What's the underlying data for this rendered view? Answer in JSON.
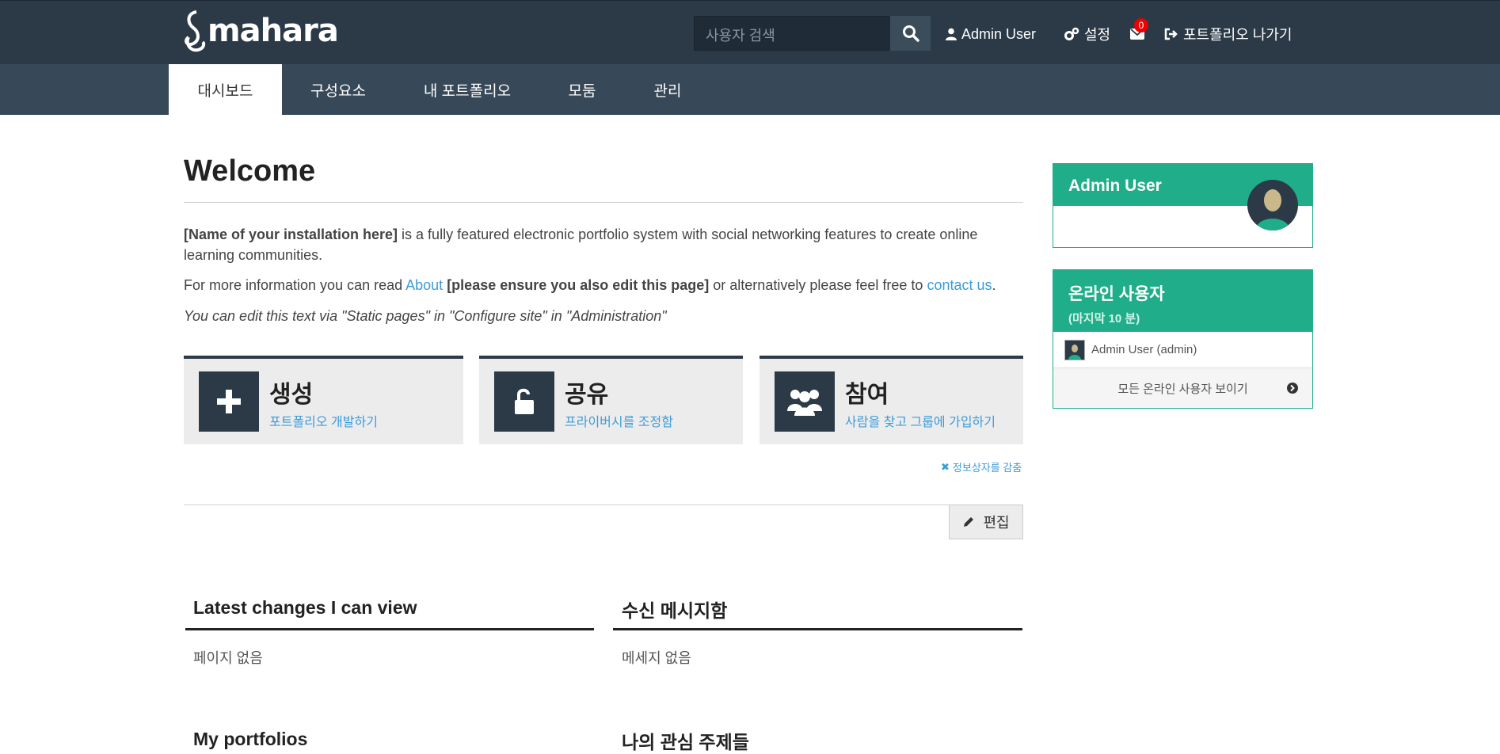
{
  "brand": {
    "logo_text": "mahara"
  },
  "header": {
    "search_placeholder": "사용자 검색",
    "user_name": "Admin User",
    "settings_label": "설정",
    "inbox_count": "0",
    "logout_label": "포트폴리오 나가기"
  },
  "nav": {
    "tabs": [
      {
        "label": "대시보드",
        "active": true
      },
      {
        "label": "구성요소",
        "active": false
      },
      {
        "label": "내 포트폴리오",
        "active": false
      },
      {
        "label": "모둠",
        "active": false
      },
      {
        "label": "관리",
        "active": false
      }
    ]
  },
  "welcome": {
    "title": "Welcome",
    "p1_bold": "[Name of your installation here]",
    "p1_rest": " is a fully featured electronic portfolio system with social networking features to create online learning communities.",
    "p2_a": "For more information you can read ",
    "p2_link1": "About",
    "p2_bold": " [please ensure you also edit this page]",
    "p2_b": " or alternatively please feel free to ",
    "p2_link2": "contact us",
    "p2_end": ".",
    "p3": "You can edit this text via \"Static pages\" in \"Configure site\" in \"Administration\""
  },
  "tiles": [
    {
      "title": "생성",
      "subtitle": "포트폴리오 개발하기",
      "icon": "plus-icon"
    },
    {
      "title": "공유",
      "subtitle": "프라이버시를 조정함",
      "icon": "unlock-icon"
    },
    {
      "title": "참여",
      "subtitle": "사람을 찾고 그룹에 가입하기",
      "icon": "users-icon"
    }
  ],
  "hide_info_label": "정보상자를 감춤",
  "edit_label": "편집",
  "blocks": {
    "latest_changes": {
      "title": "Latest changes I can view",
      "empty": "페이지 없음"
    },
    "inbox": {
      "title": "수신 메시지함",
      "empty": "메세지 없음"
    },
    "my_portfolios": {
      "title": "My portfolios"
    },
    "topics": {
      "title": "나의 관심 주제들"
    }
  },
  "sidebar": {
    "profile": {
      "name": "Admin User"
    },
    "online": {
      "title": "온라인 사용자",
      "subtitle": "(마지막 10 분)",
      "users": [
        "Admin User (admin)"
      ],
      "show_all": "모든 온라인 사용자 보이기"
    }
  },
  "colors": {
    "header": "#2c3a47",
    "nav": "#374858",
    "accent": "#1fae89",
    "link": "#3b9cd9",
    "badge": "#ee0000"
  }
}
